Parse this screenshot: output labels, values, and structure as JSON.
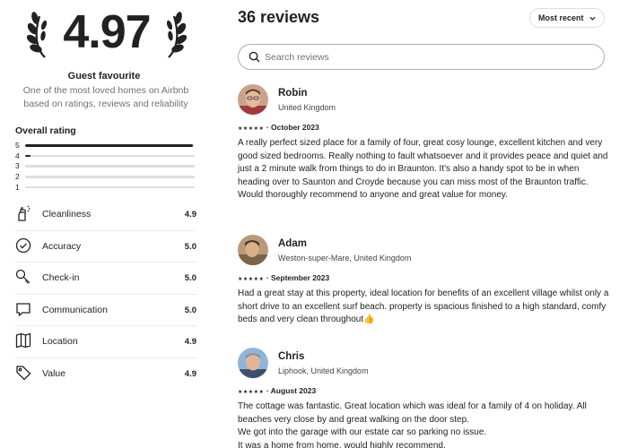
{
  "summary": {
    "score": "4.97",
    "badge_title": "Guest favourite",
    "badge_description": "One of the most loved homes on Airbnb based on ratings, reviews and reliability"
  },
  "overall": {
    "label": "Overall rating",
    "bars": [
      {
        "star": "5",
        "fraction": 0.99
      },
      {
        "star": "4",
        "fraction": 0.03
      },
      {
        "star": "3",
        "fraction": 0.0
      },
      {
        "star": "2",
        "fraction": 0.0
      },
      {
        "star": "1",
        "fraction": 0.0
      }
    ]
  },
  "categories": [
    {
      "name": "Cleanliness",
      "value": "4.9",
      "icon": "spray-bottle-icon"
    },
    {
      "name": "Accuracy",
      "value": "5.0",
      "icon": "check-circle-icon"
    },
    {
      "name": "Check-in",
      "value": "5.0",
      "icon": "key-icon"
    },
    {
      "name": "Communication",
      "value": "5.0",
      "icon": "chat-bubble-icon"
    },
    {
      "name": "Location",
      "value": "4.9",
      "icon": "map-icon"
    },
    {
      "name": "Value",
      "value": "4.9",
      "icon": "tag-icon"
    }
  ],
  "reviews_header": {
    "title": "36 reviews",
    "sort_label": "Most recent"
  },
  "search": {
    "placeholder": "Search reviews",
    "value": ""
  },
  "reviews": [
    {
      "name": "Robin",
      "location": "United Kingdom",
      "stars": "★★★★★",
      "date": "October 2023",
      "text": "A really perfect sized place for a family of four, great cosy lounge, excellent kitchen and very good sized bedrooms. Really nothing to fault whatsoever and it provides peace and quiet and just a 2 minute walk from things to do in Braunton. It's also a handy spot to be in when heading over to Saunton and Croyde because you can miss most of the Braunton traffic.\nWould thoroughly recommend to anyone and great value for money."
    },
    {
      "name": "Adam",
      "location": "Weston-super-Mare, United Kingdom",
      "stars": "★★★★★",
      "date": "September 2023",
      "text": "Had a great stay at this property, ideal location for benefits of an excellent village whilst only a short drive to an excellent surf beach. property is spacious finished to a high standard, comfy beds and very clean throughout👍"
    },
    {
      "name": "Chris",
      "location": "Liphook, United Kingdom",
      "stars": "★★★★★",
      "date": "August 2023",
      "text": "The cottage was fantastic. Great location which was ideal for a family of 4 on holiday. All beaches very close by and great walking on the door step.\nWe got into the garage with our estate car so parking no issue.\nIt was a home from home, would highly recommend."
    }
  ],
  "colors": {
    "text": "#222222",
    "muted": "#717171",
    "bar_track": "#dddddd",
    "divider": "#ebebeb"
  }
}
